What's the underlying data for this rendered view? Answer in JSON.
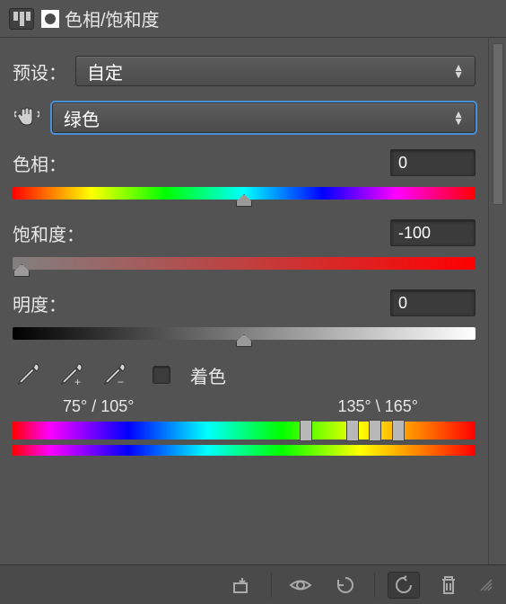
{
  "header": {
    "title": "色相/饱和度"
  },
  "preset": {
    "label": "预设：",
    "value": "自定"
  },
  "channel": {
    "value": "绿色"
  },
  "sliders": {
    "hue": {
      "label": "色相：",
      "value": "0",
      "pos": 50
    },
    "sat": {
      "label": "饱和度：",
      "value": "-100",
      "pos": 0
    },
    "light": {
      "label": "明度：",
      "value": "0",
      "pos": 50
    }
  },
  "colorize": {
    "label": "着色"
  },
  "range": {
    "a": "75°",
    "b": "105°",
    "c": "135°",
    "d": "165°"
  }
}
